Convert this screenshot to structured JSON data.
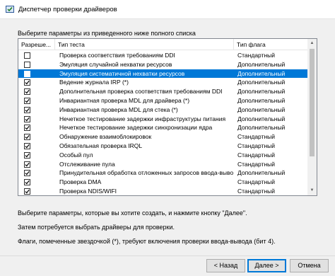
{
  "window": {
    "title": "Диспетчер проверки драйверов"
  },
  "prompt": "Выберите параметры из приведенного ниже полного списка",
  "table": {
    "columns": [
      "Разреше...",
      "Тип теста",
      "Тип флага"
    ],
    "rows": [
      {
        "checked": false,
        "name": "Проверка соответствия требованиям DDI",
        "flag": "Стандартный",
        "selected": false
      },
      {
        "checked": false,
        "name": "Эмуляция случайной нехватки ресурсов",
        "flag": "Дополнительный",
        "selected": false
      },
      {
        "checked": true,
        "name": "Эмуляция систематичной нехватки ресурсов",
        "flag": "Дополнительный",
        "selected": true
      },
      {
        "checked": true,
        "name": "Ведение журнала IRP (*)",
        "flag": "Дополнительный",
        "selected": false
      },
      {
        "checked": true,
        "name": "Дополнительная проверка соответствия требованиям DDI",
        "flag": "Дополнительный",
        "selected": false
      },
      {
        "checked": true,
        "name": "Инвариантная проверка MDL для драйвера (*)",
        "flag": "Дополнительный",
        "selected": false
      },
      {
        "checked": true,
        "name": "Инвариантная проверка MDL для стека (*)",
        "flag": "Дополнительный",
        "selected": false
      },
      {
        "checked": true,
        "name": "Нечеткое тестирование задержки инфраструктуры питания",
        "flag": "Дополнительный",
        "selected": false
      },
      {
        "checked": true,
        "name": "Нечеткое тестирование задержки синхронизации ядра",
        "flag": "Дополнительный",
        "selected": false
      },
      {
        "checked": true,
        "name": "Обнаружение взаимоблокировок",
        "flag": "Стандартный",
        "selected": false
      },
      {
        "checked": true,
        "name": "Обязательная проверка IRQL",
        "flag": "Стандартный",
        "selected": false
      },
      {
        "checked": true,
        "name": "Особый пул",
        "flag": "Стандартный",
        "selected": false
      },
      {
        "checked": true,
        "name": "Отслеживание пула",
        "flag": "Стандартный",
        "selected": false
      },
      {
        "checked": true,
        "name": "Принудительная обработка отложенных запросов ввода-вывода",
        "flag": "Дополнительный",
        "selected": false
      },
      {
        "checked": true,
        "name": "Проверка DMA",
        "flag": "Стандартный",
        "selected": false
      },
      {
        "checked": true,
        "name": "Проверка NDIS/WIFI",
        "flag": "Стандартный",
        "selected": false
      }
    ]
  },
  "hints": [
    "Выберите параметры, которые вы хотите создать, и нажмите кнопку \"Далее\".",
    "Затем потребуется выбрать драйверы для проверки.",
    "Флаги, помеченные звездочкой (*), требуют включения проверки ввода-вывода (бит 4)."
  ],
  "buttons": {
    "back": "< Назад",
    "next": "Далее >",
    "cancel": "Отмена"
  },
  "colors": {
    "selection": "#0078d7",
    "default_button_border": "#0078d7"
  }
}
